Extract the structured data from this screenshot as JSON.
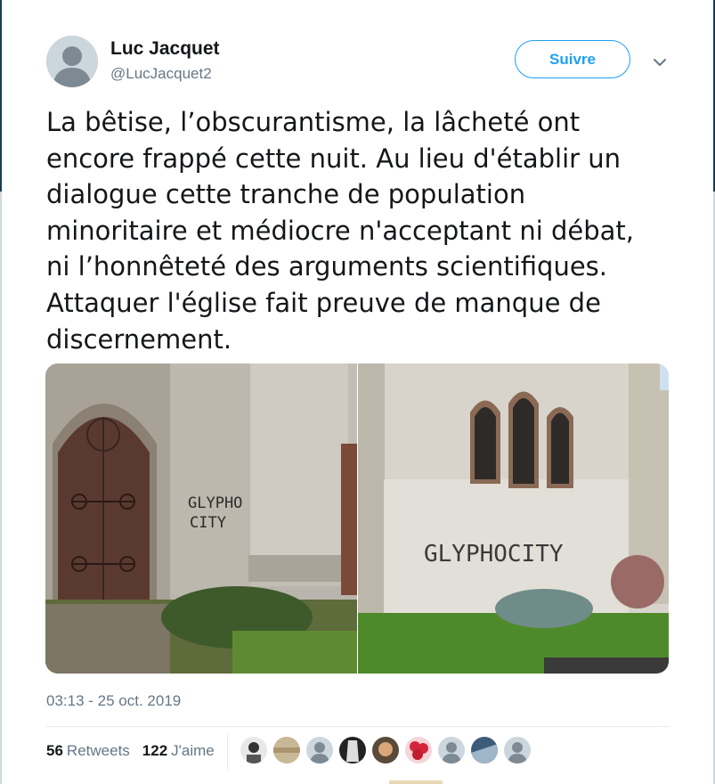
{
  "author": {
    "name": "Luc Jacquet",
    "handle": "@LucJacquet2"
  },
  "follow_label": "Suivre",
  "tweet_text": "La bêtise, l’obscurantisme, la lâcheté ont\nencore frappé cette nuit. Au lieu d'établir un\ndialogue cette tranche de population\nminoritaire et médiocre n'acceptant ni débat,\nni l’honnêteté des arguments scientifiques.\nAttaquer l'église fait preuve de manque de\ndiscernement.",
  "media": {
    "graffiti_left": [
      "GLYPHO",
      "CITY"
    ],
    "graffiti_right": "GLYPHOCITY"
  },
  "timestamp": "03:13 - 25 oct. 2019",
  "stats": {
    "retweets_count": "56",
    "retweets_label": "Retweets",
    "likes_count": "122",
    "likes_label": "J'aime"
  },
  "likers": [
    "default",
    "photo",
    "default",
    "photo",
    "photo",
    "photo",
    "default",
    "photo",
    "default"
  ],
  "colors": {
    "accent": "#1da1f2",
    "muted": "#657786",
    "text": "#14171a",
    "divider": "#e6ecf0"
  }
}
